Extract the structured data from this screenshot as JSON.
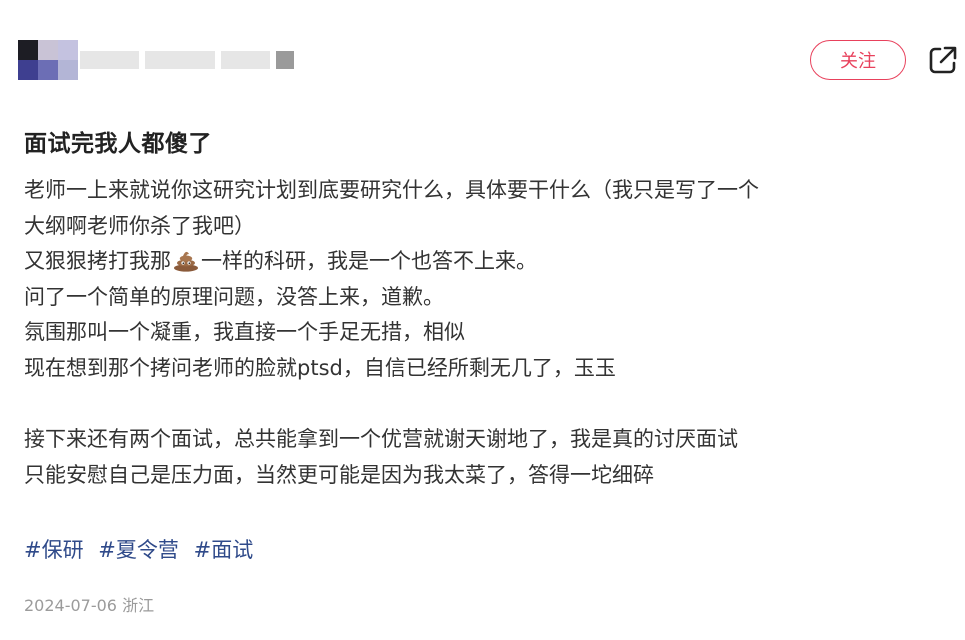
{
  "header": {
    "follow_label": "关注",
    "icons": {
      "share": "share-external-icon"
    }
  },
  "post": {
    "title": "面试完我人都傻了",
    "lines": [
      "老师一上来就说你这研究计划到底要研究什么，具体要干什么（我只是写了一个",
      "大纲啊老师你杀了我吧）",
      "又狠狠拷打我那",
      "一样的科研，我是一个也答不上来。",
      "问了一个简单的原理问题，没答上来，道歉。",
      "氛围那叫一个凝重，我直接一个手足无措，相似",
      "现在想到那个拷问老师的脸就ptsd，自信已经所剩无几了，玉玉",
      "接下来还有两个面试，总共能拿到一个优营就谢天谢地了，我是真的讨厌面试",
      "只能安慰自己是压力面，当然更可能是因为我太菜了，答得一坨细碎"
    ],
    "emoji": "pile-of-poo-emoji",
    "tags": [
      "#保研",
      "#夏令营",
      "#面试"
    ],
    "date": "2024-07-06",
    "location": "浙江"
  },
  "colors": {
    "accent": "#e8415c",
    "tag": "#2f4a8a",
    "meta": "#9b9b9b"
  }
}
